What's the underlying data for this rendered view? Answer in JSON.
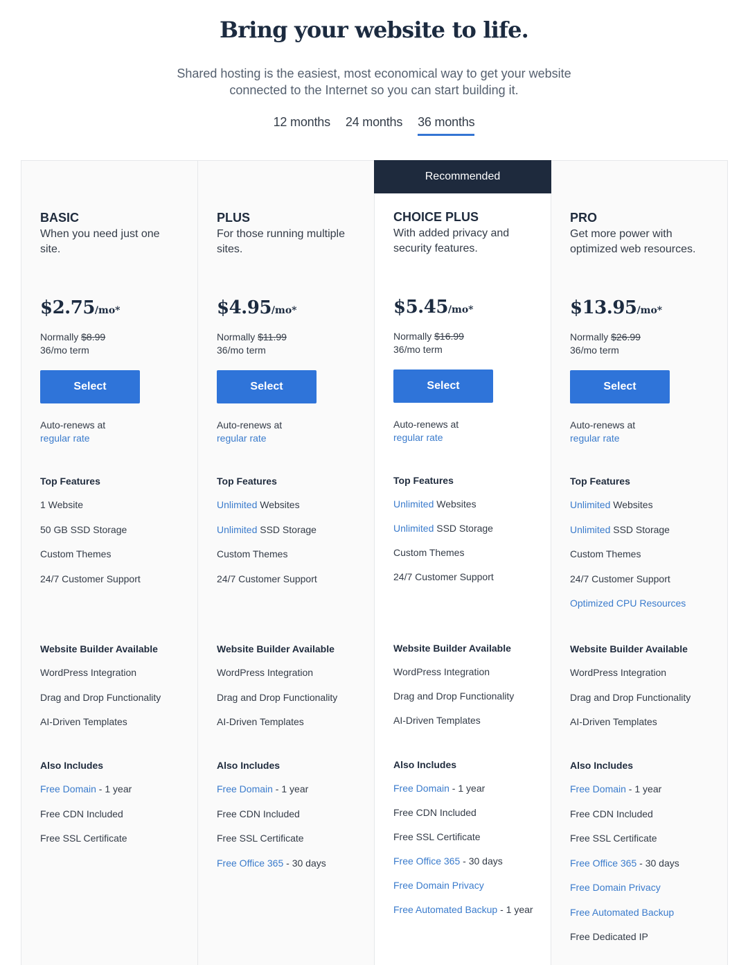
{
  "hero": {
    "title": "Bring your website to life.",
    "subtitle": "Shared hosting is the easiest, most economical way to get your website connected to the Internet so you can start building it."
  },
  "term_tabs": [
    {
      "label": "12 months",
      "active": false
    },
    {
      "label": "24 months",
      "active": false
    },
    {
      "label": "36 months",
      "active": true
    }
  ],
  "colors": {
    "accent": "#2f74d9",
    "link": "#3a7bcc",
    "navy": "#1e2a3d",
    "card_bg": "#fafafa"
  },
  "plans": [
    {
      "name": "BASIC",
      "description": "When you need just one site.",
      "price": "$2.75",
      "price_unit": "/mo*",
      "normally_label": "Normally",
      "normal_price": "$8.99",
      "term": "36/mo term",
      "select_label": "Select",
      "renew_text": "Auto-renews at",
      "renew_link": "regular rate",
      "top_features_title": "Top Features",
      "top_features": [
        {
          "highlight": "",
          "text": "1 Website"
        },
        {
          "highlight": "",
          "text": "50 GB SSD Storage"
        },
        {
          "highlight": "",
          "text": "Custom Themes"
        },
        {
          "highlight": "",
          "text": "24/7 Customer Support"
        }
      ],
      "builder_title": "Website Builder Available",
      "builder_features": [
        "WordPress Integration",
        "Drag and Drop Functionality",
        "AI-Driven Templates"
      ],
      "also_title": "Also Includes",
      "also_includes": [
        {
          "highlight": "Free Domain",
          "text": " - 1 year"
        },
        {
          "highlight": "",
          "text": "Free CDN Included"
        },
        {
          "highlight": "",
          "text": "Free SSL Certificate"
        }
      ]
    },
    {
      "name": "PLUS",
      "description": "For those running multiple sites.",
      "price": "$4.95",
      "price_unit": "/mo*",
      "normally_label": "Normally",
      "normal_price": "$11.99",
      "term": "36/mo term",
      "select_label": "Select",
      "renew_text": "Auto-renews at",
      "renew_link": "regular rate",
      "top_features_title": "Top Features",
      "top_features": [
        {
          "highlight": "Unlimited",
          "text": " Websites"
        },
        {
          "highlight": "Unlimited",
          "text": " SSD Storage"
        },
        {
          "highlight": "",
          "text": "Custom Themes"
        },
        {
          "highlight": "",
          "text": "24/7 Customer Support"
        }
      ],
      "builder_title": "Website Builder Available",
      "builder_features": [
        "WordPress Integration",
        "Drag and Drop Functionality",
        "AI-Driven Templates"
      ],
      "also_title": "Also Includes",
      "also_includes": [
        {
          "highlight": "Free Domain",
          "text": " - 1 year"
        },
        {
          "highlight": "",
          "text": "Free CDN Included"
        },
        {
          "highlight": "",
          "text": "Free SSL Certificate"
        },
        {
          "highlight": "Free Office 365",
          "text": " - 30 days"
        }
      ]
    },
    {
      "name": "CHOICE PLUS",
      "recommended_label": "Recommended",
      "description": "With added privacy and security features.",
      "price": "$5.45",
      "price_unit": "/mo*",
      "normally_label": "Normally",
      "normal_price": "$16.99",
      "term": "36/mo term",
      "select_label": "Select",
      "renew_text": "Auto-renews at",
      "renew_link": "regular rate",
      "top_features_title": "Top Features",
      "top_features": [
        {
          "highlight": "Unlimited",
          "text": " Websites"
        },
        {
          "highlight": "Unlimited",
          "text": " SSD Storage"
        },
        {
          "highlight": "",
          "text": "Custom Themes"
        },
        {
          "highlight": "",
          "text": "24/7 Customer Support"
        }
      ],
      "builder_title": "Website Builder Available",
      "builder_features": [
        "WordPress Integration",
        "Drag and Drop Functionality",
        "AI-Driven Templates"
      ],
      "also_title": "Also Includes",
      "also_includes": [
        {
          "highlight": "Free Domain",
          "text": " - 1 year"
        },
        {
          "highlight": "",
          "text": "Free CDN Included"
        },
        {
          "highlight": "",
          "text": "Free SSL Certificate"
        },
        {
          "highlight": "Free Office 365",
          "text": " - 30 days"
        },
        {
          "highlight": "Free Domain Privacy",
          "text": ""
        },
        {
          "highlight": "Free Automated Backup",
          "text": " - 1 year"
        }
      ]
    },
    {
      "name": "PRO",
      "description": "Get more power with optimized web resources.",
      "price": "$13.95",
      "price_unit": "/mo*",
      "normally_label": "Normally",
      "normal_price": "$26.99",
      "term": "36/mo term",
      "select_label": "Select",
      "renew_text": "Auto-renews at",
      "renew_link": "regular rate",
      "top_features_title": "Top Features",
      "top_features": [
        {
          "highlight": "Unlimited",
          "text": " Websites"
        },
        {
          "highlight": "Unlimited",
          "text": " SSD Storage"
        },
        {
          "highlight": "",
          "text": "Custom Themes"
        },
        {
          "highlight": "",
          "text": "24/7 Customer Support"
        },
        {
          "highlight": "Optimized CPU Resources",
          "text": ""
        }
      ],
      "builder_title": "Website Builder Available",
      "builder_features": [
        "WordPress Integration",
        "Drag and Drop Functionality",
        "AI-Driven Templates"
      ],
      "also_title": "Also Includes",
      "also_includes": [
        {
          "highlight": "Free Domain",
          "text": " - 1 year"
        },
        {
          "highlight": "",
          "text": "Free CDN Included"
        },
        {
          "highlight": "",
          "text": "Free SSL Certificate"
        },
        {
          "highlight": "Free Office 365",
          "text": " - 30 days"
        },
        {
          "highlight": "Free Domain Privacy",
          "text": ""
        },
        {
          "highlight": "Free Automated Backup",
          "text": ""
        },
        {
          "highlight": "",
          "text": "Free Dedicated IP"
        }
      ]
    }
  ]
}
